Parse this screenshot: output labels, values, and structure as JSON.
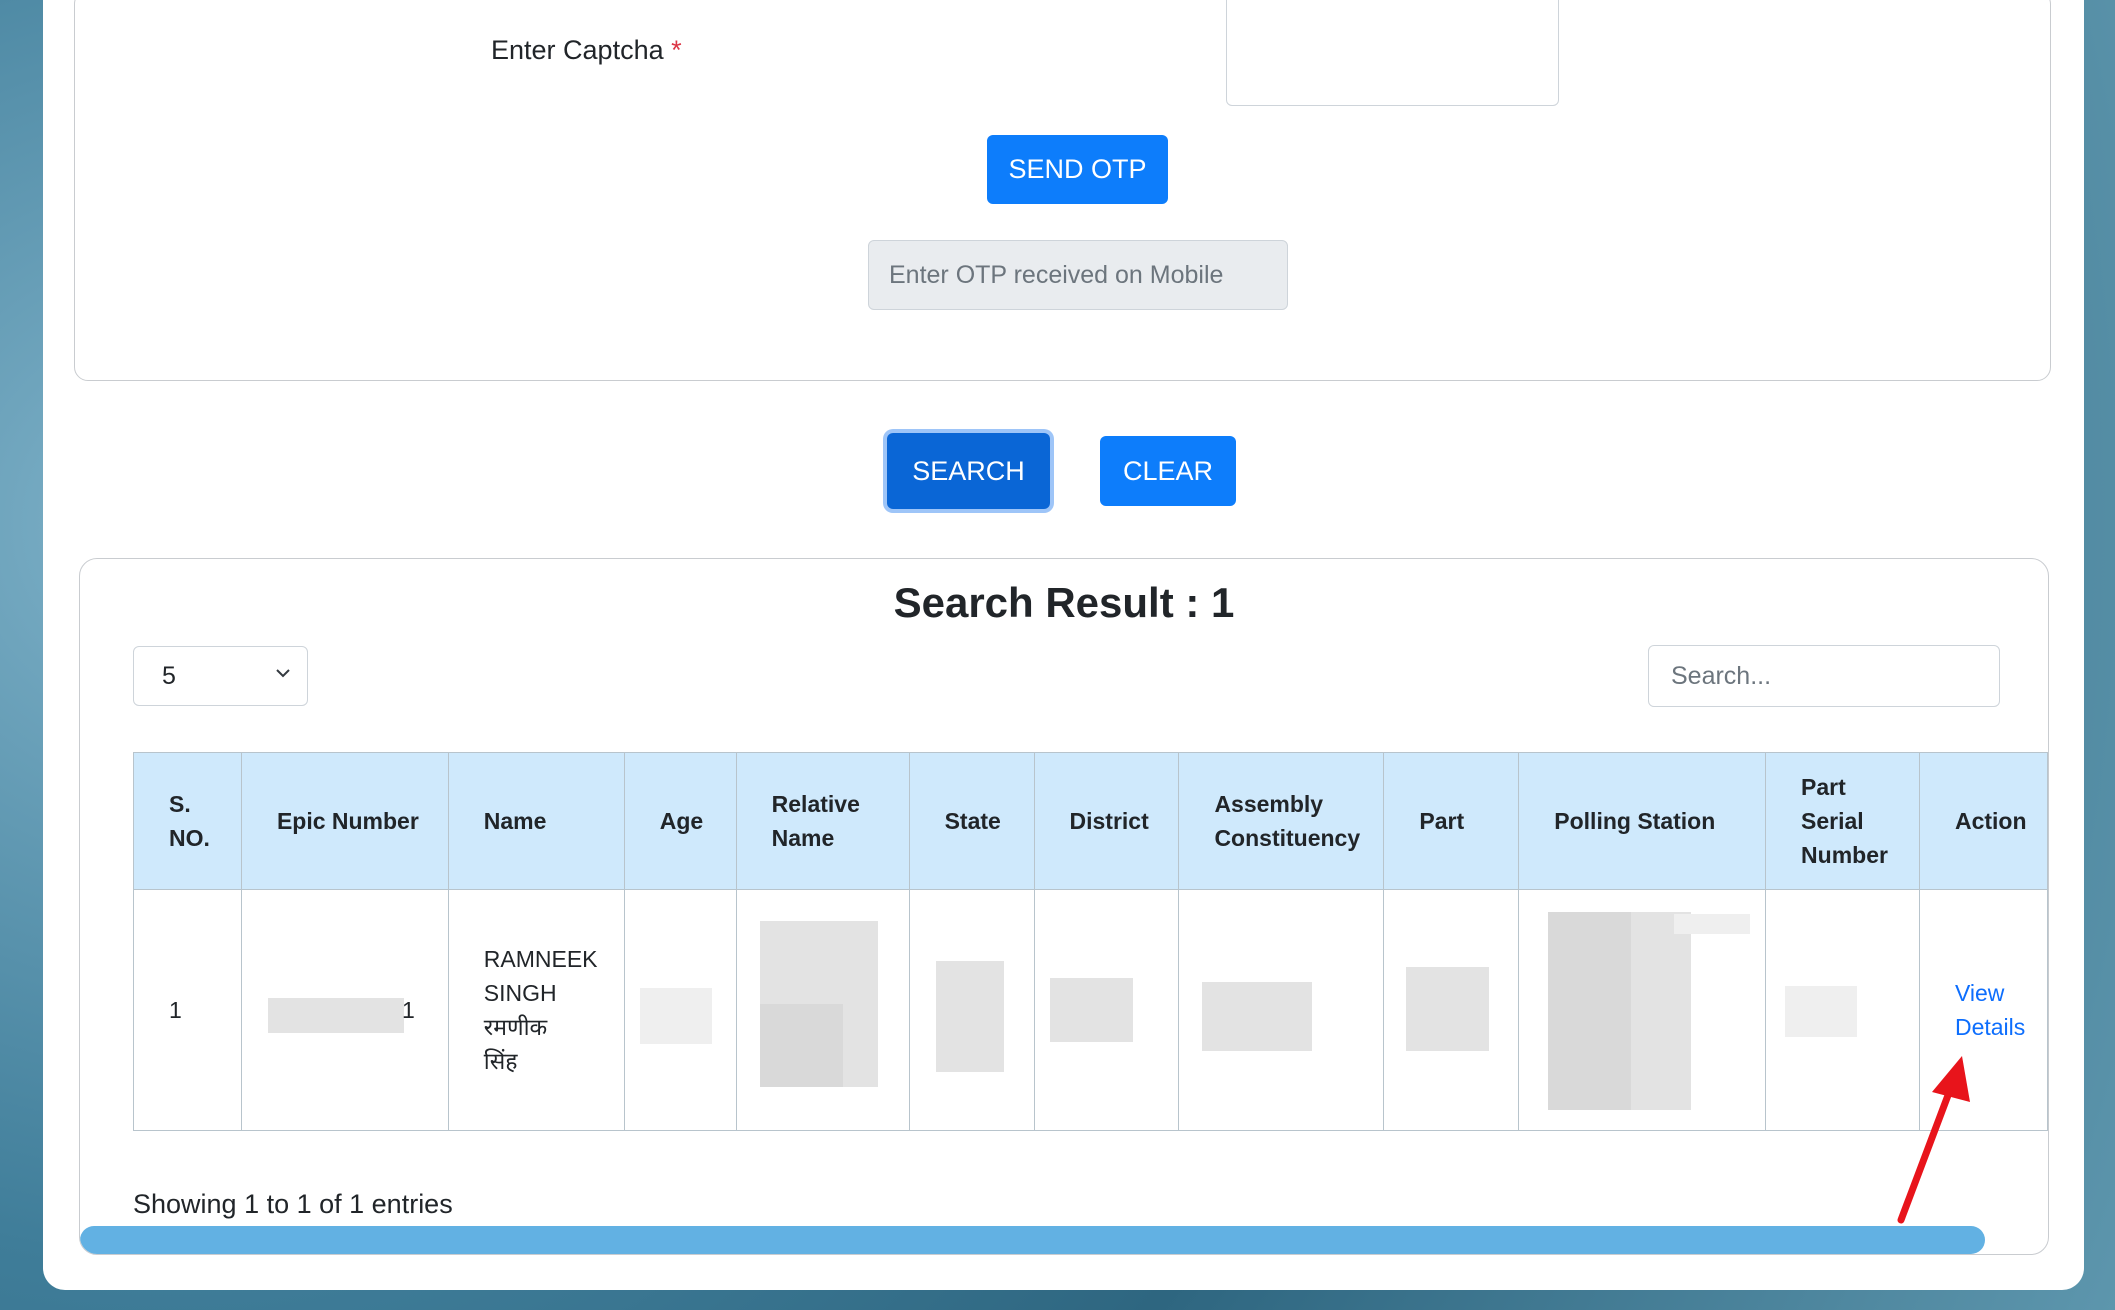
{
  "form": {
    "captcha_label": "Enter Captcha",
    "captcha_required": "*",
    "send_otp_label": "SEND OTP",
    "otp_placeholder": "Enter OTP received on Mobile"
  },
  "actions": {
    "search_label": "SEARCH",
    "clear_label": "CLEAR"
  },
  "results": {
    "title": "Search Result : 1",
    "page_size": "5",
    "search_placeholder": "Search...",
    "columns": {
      "sno_1": "S.",
      "sno_2": "NO.",
      "epic": "Epic Number",
      "name": "Name",
      "age": "Age",
      "relative_1": "Relative",
      "relative_2": "Name",
      "state": "State",
      "district": "District",
      "assembly_1": "Assembly",
      "assembly_2": "Constituency",
      "part": "Part",
      "polling": "Polling Station",
      "serial_1": "Part",
      "serial_2": "Serial",
      "serial_3": "Number",
      "action": "Action"
    },
    "row": {
      "sno": "1",
      "epic_tail": "1",
      "name_1": "RAMNEEK",
      "name_2": "SINGH",
      "name_3": "रमणीक",
      "name_4": "सिंह",
      "view_1": "View",
      "view_2": "Details"
    },
    "footer": "Showing 1 to 1 of 1 entries"
  },
  "colors": {
    "primary_button": "#0d7dfb",
    "header_bg": "#cfe9fc",
    "link": "#0d6efd",
    "annotation_arrow": "#e8141b"
  }
}
